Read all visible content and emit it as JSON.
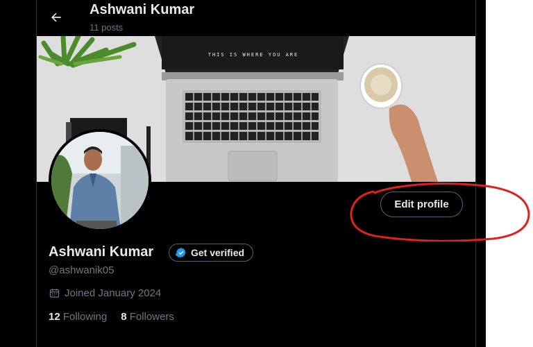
{
  "header": {
    "name": "Ashwani Kumar",
    "posts": "11 posts"
  },
  "banner": {
    "laptop_screen_text": "THIS IS WHERE YOU ARE"
  },
  "profile": {
    "display_name": "Ashwani Kumar",
    "get_verified_label": "Get verified",
    "handle": "@ashwanik05",
    "joined": "Joined January 2024",
    "following_count": "12",
    "following_label": "Following",
    "followers_count": "8",
    "followers_label": "Followers"
  },
  "actions": {
    "edit_profile_label": "Edit profile"
  },
  "colors": {
    "background": "#000000",
    "text_primary": "#e7e9ea",
    "text_secondary": "#71767b",
    "verified_blue": "#1d9bf0",
    "annotation_red": "#e0201d"
  }
}
